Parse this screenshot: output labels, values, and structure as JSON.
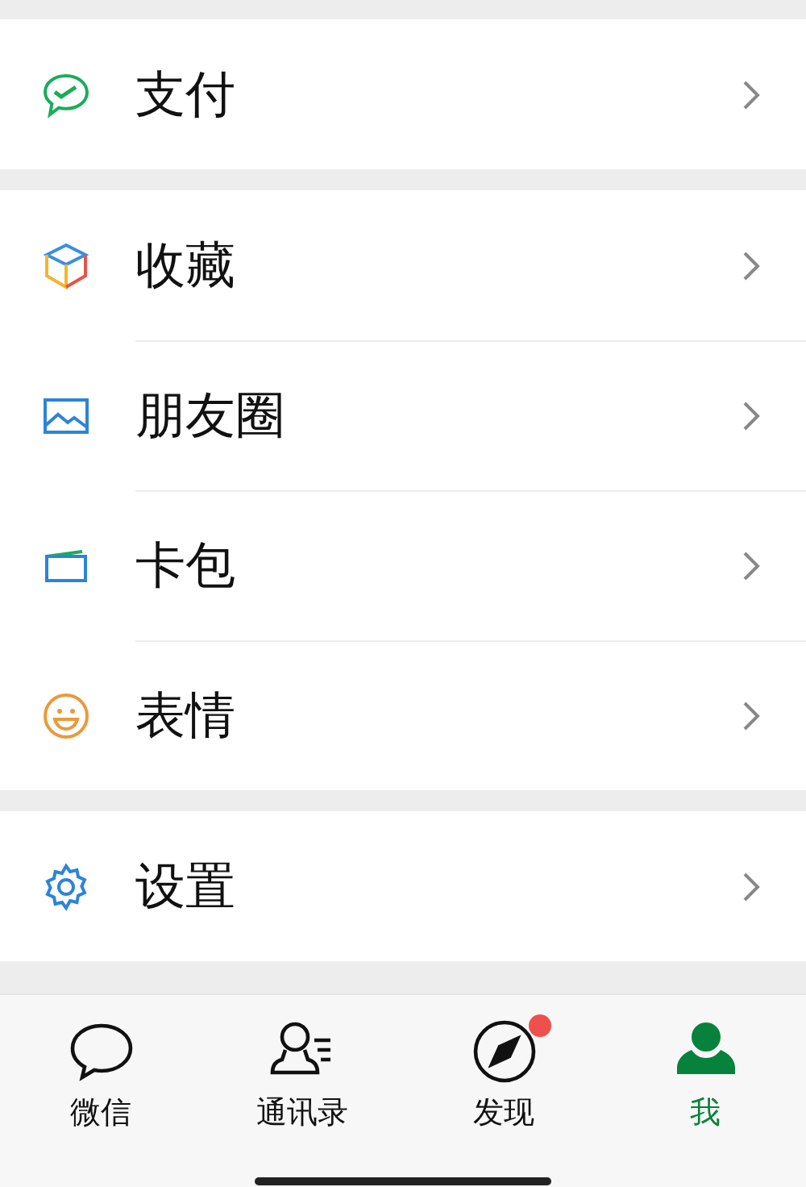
{
  "groups": [
    {
      "items": [
        {
          "kind": "pay",
          "label": "支付"
        }
      ]
    },
    {
      "items": [
        {
          "kind": "favorites",
          "label": "收藏"
        },
        {
          "kind": "moments",
          "label": "朋友圈"
        },
        {
          "kind": "cards",
          "label": "卡包"
        },
        {
          "kind": "stickers",
          "label": "表情"
        }
      ]
    },
    {
      "items": [
        {
          "kind": "settings",
          "label": "设置"
        }
      ]
    }
  ],
  "tabs": [
    {
      "kind": "chats",
      "label": "微信",
      "selected": false,
      "badge": false
    },
    {
      "kind": "contacts",
      "label": "通讯录",
      "selected": false,
      "badge": false
    },
    {
      "kind": "discover",
      "label": "发现",
      "selected": false,
      "badge": true
    },
    {
      "kind": "me",
      "label": "我",
      "selected": true,
      "badge": false
    }
  ]
}
